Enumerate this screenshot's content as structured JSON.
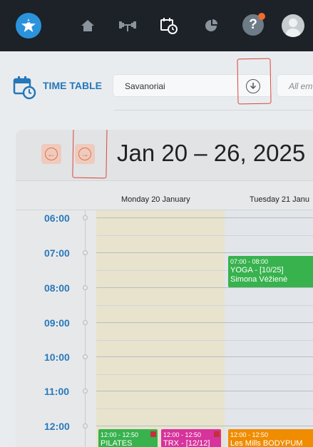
{
  "nav": {
    "help_label": "?"
  },
  "toolbar": {
    "title": "TIME TABLE",
    "site": "Savanoriai",
    "employees_placeholder": "All em"
  },
  "calendar": {
    "week_title": "Jan 20 – 26, 2025",
    "days": [
      "Monday 20 January",
      "Tuesday 21 Janu"
    ],
    "hours": [
      "06:00",
      "07:00",
      "08:00",
      "09:00",
      "10:00",
      "11:00",
      "12:00"
    ],
    "events": [
      {
        "time": "07:00 - 08:00",
        "title": "YOGA - [10/25]",
        "trainer": "Simona Vėžienė",
        "color": "#37b24d"
      },
      {
        "time": "12:00 - 12:50",
        "title": "PILATES",
        "color": "#37b24d"
      },
      {
        "time": "12:00 - 12:50",
        "title": "TRX - [12/12]",
        "color": "#d6339c"
      },
      {
        "time": "12:00 - 12:50",
        "title": "Les Mills BODYPUM",
        "color": "#f08c00"
      }
    ]
  },
  "colors": {
    "nav_bg": "#1c2227",
    "brand_blue": "#2b93dc",
    "title_blue": "#2477b8",
    "annotation_red": "#d9453a"
  }
}
